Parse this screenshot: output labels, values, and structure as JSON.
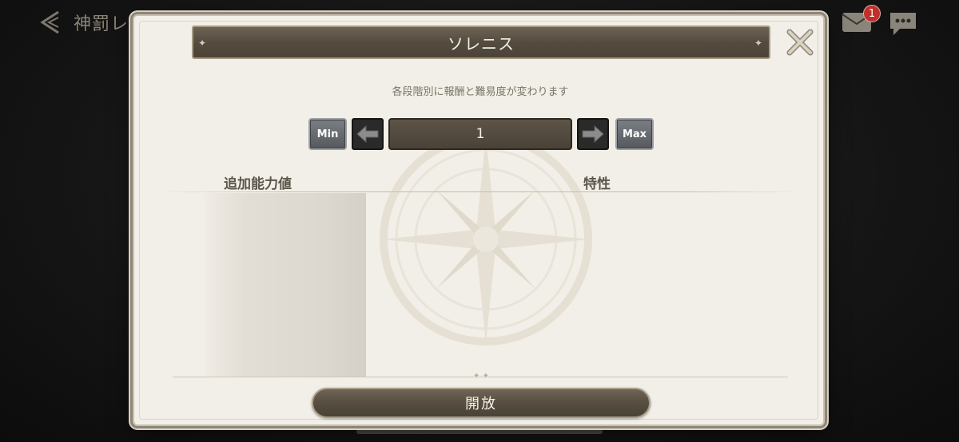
{
  "background": {
    "screen_title": "神罰レ",
    "mail_badge_count": "1"
  },
  "modal": {
    "title": "ソレニス",
    "subtitle": "各段階別に報酬と難易度が変わります",
    "min_label": "Min",
    "max_label": "Max",
    "stage_value": "1",
    "left_column_header": "追加能力値",
    "right_column_header": "特性",
    "open_button_label": "開放"
  },
  "colors": {
    "modal_bg": "#f2efe8",
    "banner_brown": "#554c40",
    "button_gray": "#6a6e73",
    "badge_red": "#c0302a"
  },
  "icons": [
    "back-arrow-icon",
    "mail-icon",
    "chat-icon",
    "close-icon",
    "arrow-left-icon",
    "arrow-right-icon",
    "compass-emblem"
  ]
}
